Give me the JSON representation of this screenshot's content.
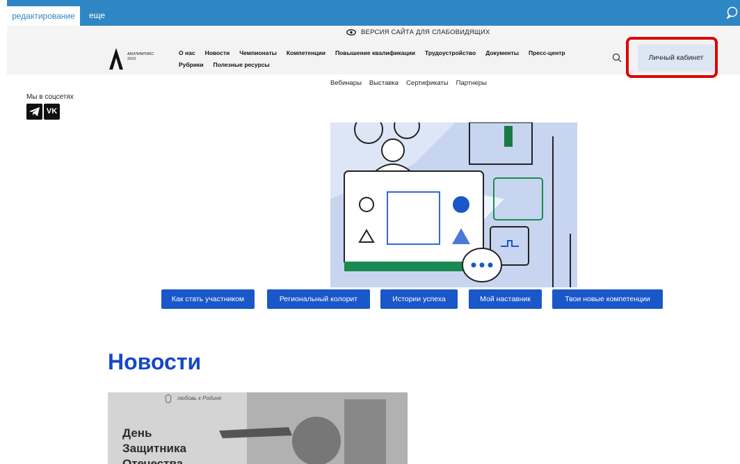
{
  "editbar": {
    "active_tab": "редактирование",
    "more_tab": "еще"
  },
  "accessibility": {
    "label": "ВЕРСИЯ САЙТА ДЛЯ СЛАБОВИДЯЩИХ"
  },
  "header": {
    "logo_name": "АБИЛИМПИКС",
    "logo_year": "2023",
    "nav": [
      "О нас",
      "Новости",
      "Чемпионаты",
      "Компетенции",
      "Повышение квалификации",
      "Трудоустройство",
      "Документы",
      "Пресс-центр",
      "Рубрики",
      "Полезные ресурсы"
    ],
    "cabinet_label": "Личный кабинет"
  },
  "subnav": [
    "Вебинары",
    "Выставка",
    "Сертификаты",
    "Партнеры"
  ],
  "social": {
    "label": "Мы в соцсетях",
    "vk": "VK"
  },
  "hero_buttons": [
    "Как стать участником",
    "Региональный колорит",
    "Истории успеха",
    "Мой наставник",
    "Твои новые компетенции"
  ],
  "news": {
    "title": "Новости",
    "card_tag": "любовь к Родине",
    "card_title_lines": [
      "День",
      "Защитника",
      "Отечества"
    ]
  },
  "colors": {
    "accent": "#1a57c9",
    "editbar": "#2f86c4",
    "highlight": "#e00000"
  }
}
